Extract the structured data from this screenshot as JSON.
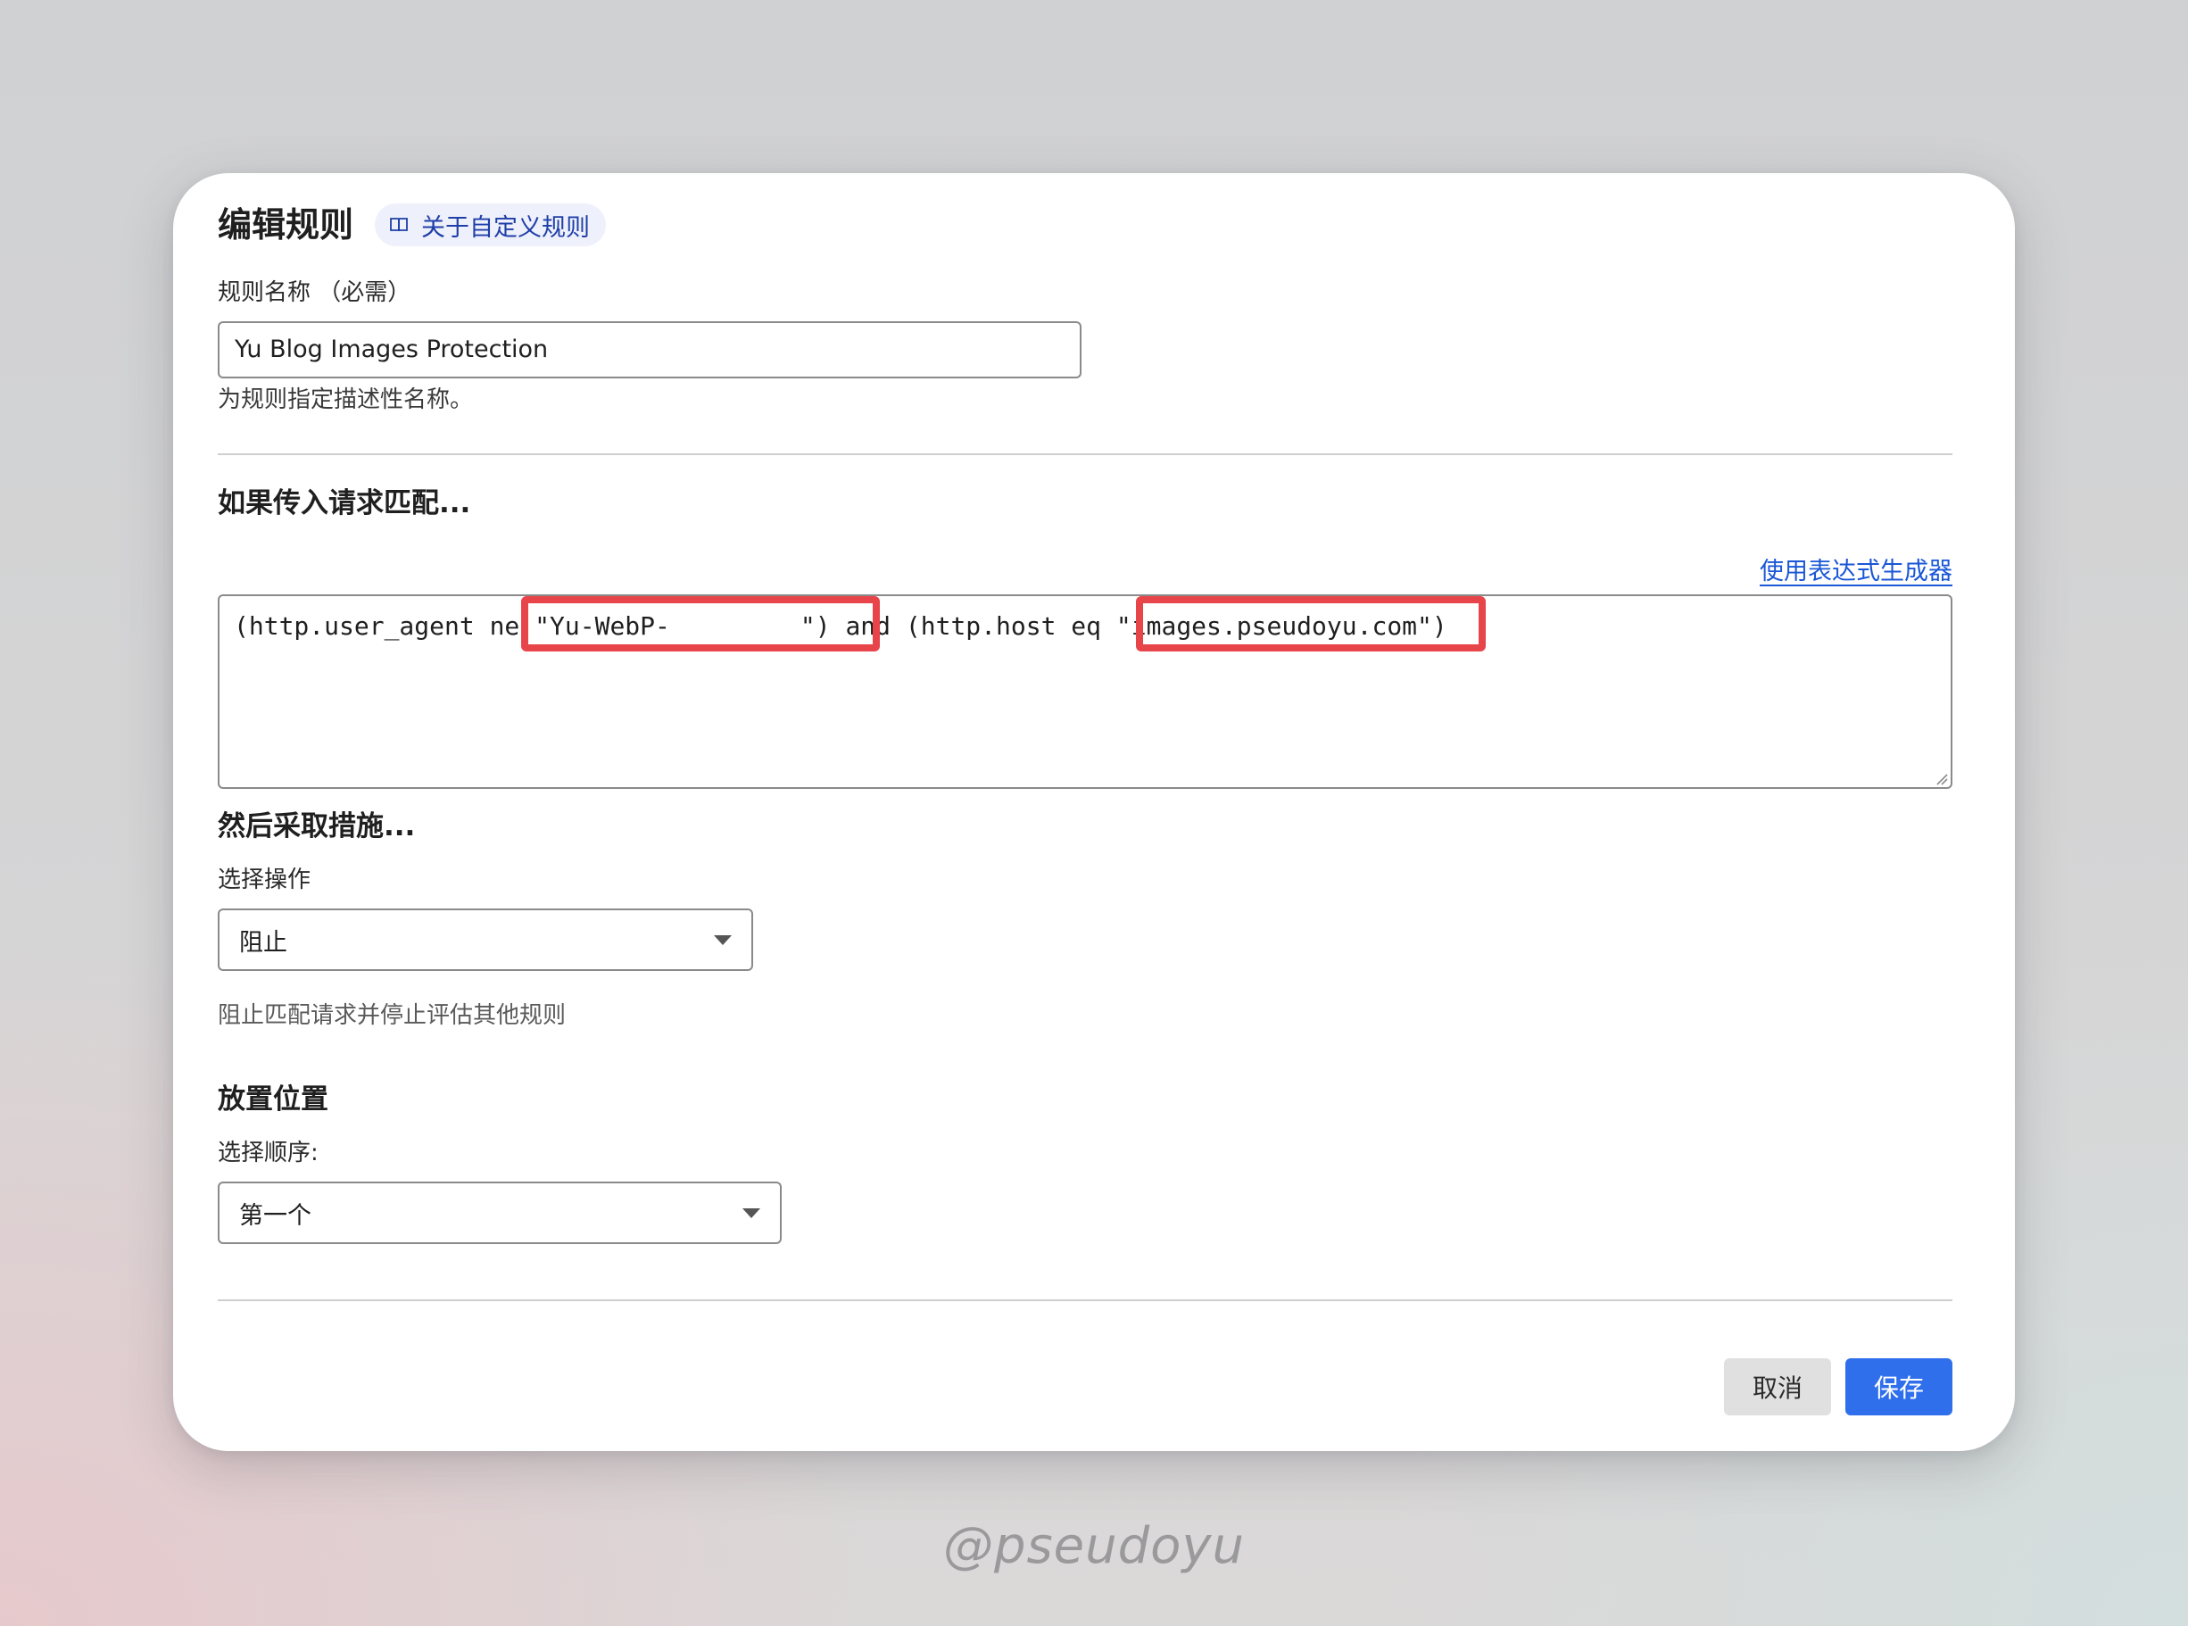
{
  "dialog": {
    "title": "编辑规则",
    "about_link": "关于自定义规则"
  },
  "rule_name": {
    "label": "规则名称 （必需）",
    "value": "Yu Blog Images Protection",
    "help": "为规则指定描述性名称。"
  },
  "match": {
    "section_title": "如果传入请求匹配...",
    "builder_link": "使用表达式生成器",
    "expression": {
      "part1": "(http.user_agent ne ",
      "ua_value": "\"Yu-WebP-",
      "part2": "\") and (http.host eq ",
      "host_value": "\"images.pseudoyu.com\"",
      "part3": ")"
    }
  },
  "action": {
    "section_title": "然后采取措施...",
    "label": "选择操作",
    "selected": "阻止",
    "description": "阻止匹配请求并停止评估其他规则"
  },
  "placement": {
    "section_title": "放置位置",
    "label": "选择顺序:",
    "selected": "第一个"
  },
  "footer": {
    "cancel_label": "取消",
    "save_label": "保存"
  },
  "watermark": "@pseudoyu",
  "colors": {
    "accent": "#2f6fec",
    "link": "#1a57d6",
    "highlight": "#e8454a"
  }
}
